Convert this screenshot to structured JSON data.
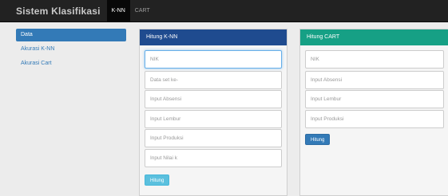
{
  "navbar": {
    "brand": "Sistem Klasifikasi",
    "items": [
      {
        "label": "K-NN",
        "active": true
      },
      {
        "label": "CART",
        "active": false
      }
    ]
  },
  "sidebar": {
    "items": [
      {
        "label": "Data",
        "active": true
      },
      {
        "label": "Akurasi K-NN",
        "active": false
      },
      {
        "label": "Akurasi Cart",
        "active": false
      }
    ]
  },
  "knn_panel": {
    "title": "Hitung K-NN",
    "fields": [
      {
        "placeholder": "NIK"
      },
      {
        "placeholder": "Data set ke-"
      },
      {
        "placeholder": "Input Absensi"
      },
      {
        "placeholder": "Input Lembur"
      },
      {
        "placeholder": "Input Produksi"
      },
      {
        "placeholder": "Input Nilai k"
      }
    ],
    "button_label": "Hitung"
  },
  "cart_panel": {
    "title": "Hitung CART",
    "fields": [
      {
        "placeholder": "NIK"
      },
      {
        "placeholder": "Input Absensi"
      },
      {
        "placeholder": "Input Lembur"
      },
      {
        "placeholder": "Input Produksi"
      }
    ],
    "button_label": "Hitung"
  },
  "colors": {
    "navbar": "#222222",
    "knn_header": "#1f4b8f",
    "cart_header": "#16a085",
    "primary": "#337ab7",
    "info": "#5bc0de"
  }
}
